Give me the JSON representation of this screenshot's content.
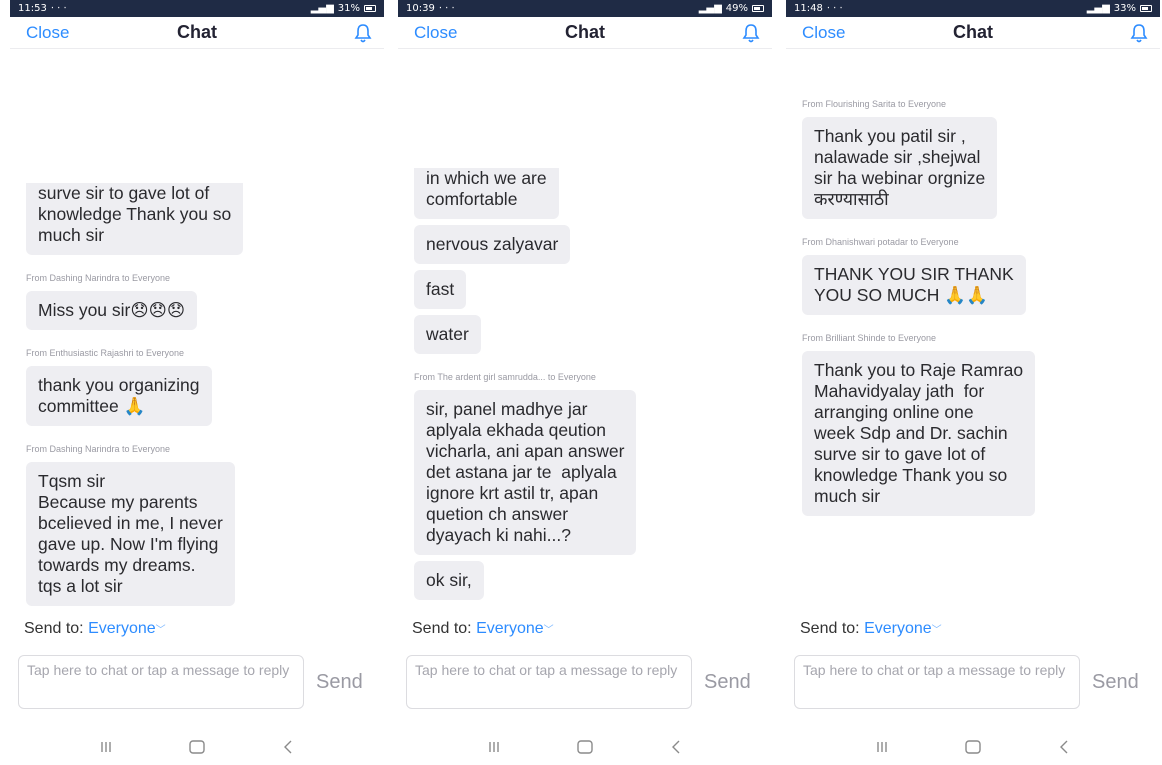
{
  "common": {
    "close_label": "Close",
    "title": "Chat",
    "send_to_label": "Send to:",
    "recipient": "Everyone",
    "input_placeholder": "Tap here to chat or tap a message to reply",
    "send_label": "Send",
    "accent_color": "#2d8cff",
    "icons": [
      "bell-icon",
      "recent-apps-icon",
      "home-icon",
      "back-icon"
    ]
  },
  "phones": [
    {
      "status_time": "11:53",
      "status_right": "31%",
      "messages": [
        {
          "sender": "",
          "text": "surve sir to gave lot of\nknowledge Thank you so\nmuch sir"
        },
        {
          "sender": "From Dashing Narindra to Everyone",
          "text": "Miss you sir😞😞😞"
        },
        {
          "sender": "From Enthusiastic Rajashri to Everyone",
          "text": "thank you organizing\ncommittee 🙏"
        },
        {
          "sender": "From Dashing Narindra to Everyone",
          "text": "Tqsm sir\nBecause my parents\nbcelieved in me, I never\ngave up. Now I'm flying\ntowards my dreams.\ntqs a lot sir"
        }
      ]
    },
    {
      "status_time": "10:39",
      "status_right": "49%",
      "messages": [
        {
          "sender": "",
          "text": "in which we are\ncomfortable"
        },
        {
          "sender": "",
          "text": "nervous zalyavar"
        },
        {
          "sender": "",
          "text": "fast"
        },
        {
          "sender": "",
          "text": "water"
        },
        {
          "sender": "From The ardent girl samrudda... to Everyone",
          "text": "sir, panel madhye jar\naplyala ekhada qeution\nvicharla, ani apan answer\ndet astana jar te  aplyala\nignore krt astil tr, apan\nquetion ch answer\ndyayach ki nahi...?"
        },
        {
          "sender": "",
          "text": "ok sir,"
        }
      ]
    },
    {
      "status_time": "11:48",
      "status_right": "33%",
      "messages": [
        {
          "sender": "From Flourishing Sarita to Everyone",
          "text": "Thank you patil sir ,\nnalawade sir ,shejwal\nsir ha webinar orgnize\nकरण्यासाठी"
        },
        {
          "sender": "From Dhanishwari potadar to Everyone",
          "text": "THANK YOU SIR THANK\nYOU SO MUCH 🙏🙏"
        },
        {
          "sender": "From Brilliant Shinde to Everyone",
          "text": "Thank you to Raje Ramrao\nMahavidyalay jath  for\narranging online one\nweek Sdp and Dr. sachin\nsurve sir to gave lot of\nknowledge Thank you so\nmuch sir"
        }
      ]
    }
  ]
}
